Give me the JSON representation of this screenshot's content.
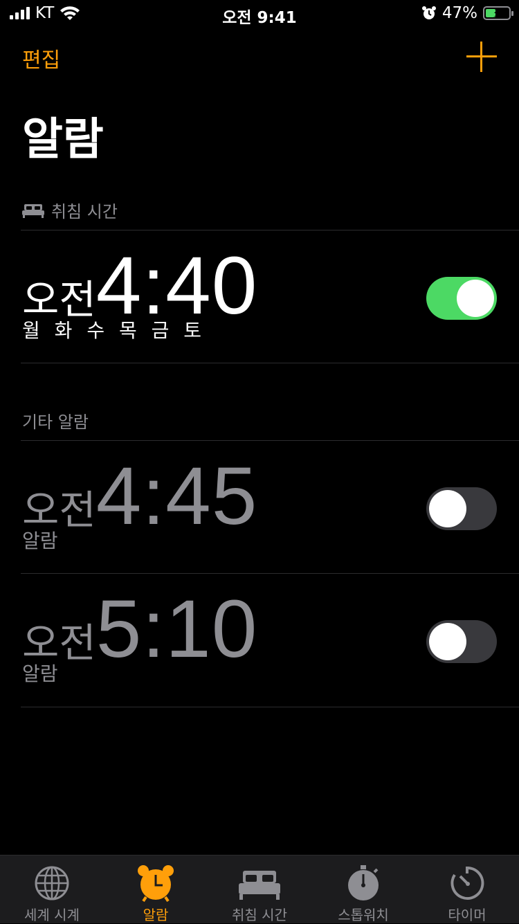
{
  "status_bar": {
    "carrier": "KT",
    "time": "오전 9:41",
    "battery": "47%",
    "battery_level": 0.47
  },
  "nav": {
    "edit_label": "편집",
    "add_icon": "plus-icon"
  },
  "page_title": "알람",
  "sections": {
    "sleep": {
      "header": "취침 시간",
      "icon": "bed-icon"
    },
    "other": {
      "header": "기타 알람"
    }
  },
  "alarms": [
    {
      "ampm": "오전",
      "time": "4:40",
      "label": "월 화 수 목 금 토",
      "enabled": true
    },
    {
      "ampm": "오전",
      "time": "4:45",
      "label": "알람",
      "enabled": false
    },
    {
      "ampm": "오전",
      "time": "5:10",
      "label": "알람",
      "enabled": false
    }
  ],
  "tab_bar": {
    "tabs": [
      {
        "label": "세계 시계",
        "icon": "globe-icon",
        "selected": false
      },
      {
        "label": "알람",
        "icon": "alarm-clock-icon",
        "selected": true
      },
      {
        "label": "취침 시간",
        "icon": "bed-icon",
        "selected": false
      },
      {
        "label": "스톱워치",
        "icon": "stopwatch-icon",
        "selected": false
      },
      {
        "label": "타이머",
        "icon": "timer-icon",
        "selected": false
      }
    ]
  },
  "colors": {
    "accent": "#ff9f0a",
    "toggle_on": "#4cd964",
    "background": "#000000",
    "secondary_text": "#8e8e93"
  }
}
